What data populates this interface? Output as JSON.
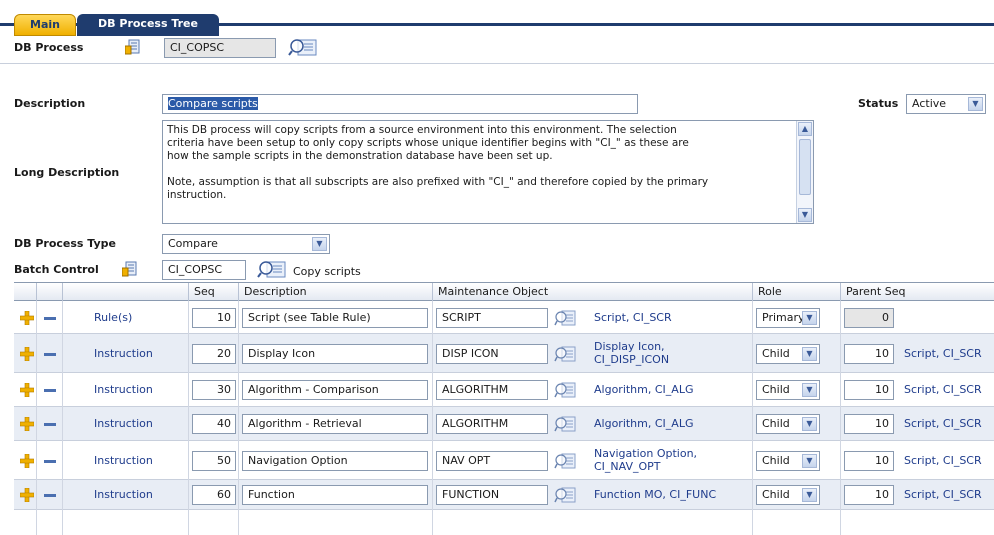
{
  "tabs": [
    {
      "label": "Main"
    },
    {
      "label": "DB Process Tree"
    }
  ],
  "form": {
    "db_process_label": "DB Process",
    "db_process_value": "CI_COPSC",
    "description_label": "Description",
    "description_value": "Compare scripts",
    "status_label": "Status",
    "status_value": "Active",
    "long_description_label": "Long Description",
    "long_description_lines": [
      "This DB process will copy scripts from a source environment into this environment.  The selection",
      "criteria have been setup to only copy scripts whose unique identifier begins with \"CI_\" as these are",
      "how the sample scripts in the demonstration database have been set up.",
      "",
      "Note, assumption is that all subscripts are also prefixed with \"CI_\" and therefore copied by the primary",
      "instruction."
    ],
    "db_process_type_label": "DB Process Type",
    "db_process_type_value": "Compare",
    "batch_control_label": "Batch Control",
    "batch_control_value": "CI_COPSC",
    "batch_control_desc": "Copy scripts"
  },
  "grid": {
    "headers": {
      "seq": "Seq",
      "description": "Description",
      "maintenance_object": "Maintenance Object",
      "role": "Role",
      "parent_seq": "Parent Seq"
    },
    "rows": [
      {
        "type": "Rule(s)",
        "seq": "10",
        "description": "Script (see Table Rule)",
        "mo": "SCRIPT",
        "mo_desc_1": "Script, CI_SCR",
        "mo_desc_2": "",
        "role": "Primary",
        "parent_seq": "0",
        "parent_desc": ""
      },
      {
        "type": "Instruction",
        "seq": "20",
        "description": "Display Icon",
        "mo": "DISP ICON",
        "mo_desc_1": "Display Icon,",
        "mo_desc_2": "CI_DISP_ICON",
        "role": "Child",
        "parent_seq": "10",
        "parent_desc": "Script, CI_SCR"
      },
      {
        "type": "Instruction",
        "seq": "30",
        "description": "Algorithm - Comparison",
        "mo": "ALGORITHM",
        "mo_desc_1": "Algorithm, CI_ALG",
        "mo_desc_2": "",
        "role": "Child",
        "parent_seq": "10",
        "parent_desc": "Script, CI_SCR"
      },
      {
        "type": "Instruction",
        "seq": "40",
        "description": "Algorithm - Retrieval",
        "mo": "ALGORITHM",
        "mo_desc_1": "Algorithm, CI_ALG",
        "mo_desc_2": "",
        "role": "Child",
        "parent_seq": "10",
        "parent_desc": "Script, CI_SCR"
      },
      {
        "type": "Instruction",
        "seq": "50",
        "description": "Navigation Option",
        "mo": "NAV OPT",
        "mo_desc_1": "Navigation Option,",
        "mo_desc_2": "CI_NAV_OPT",
        "role": "Child",
        "parent_seq": "10",
        "parent_desc": "Script, CI_SCR"
      },
      {
        "type": "Instruction",
        "seq": "60",
        "description": "Function",
        "mo": "FUNCTION",
        "mo_desc_1": "Function MO, CI_FUNC",
        "mo_desc_2": "",
        "role": "Child",
        "parent_seq": "10",
        "parent_desc": "Script, CI_SCR"
      }
    ]
  },
  "colors": {
    "tab_active": "#f0b000",
    "tab_inactive": "#1f3c6e",
    "link": "#1f3c8c",
    "row_alt": "#e8edf5"
  }
}
